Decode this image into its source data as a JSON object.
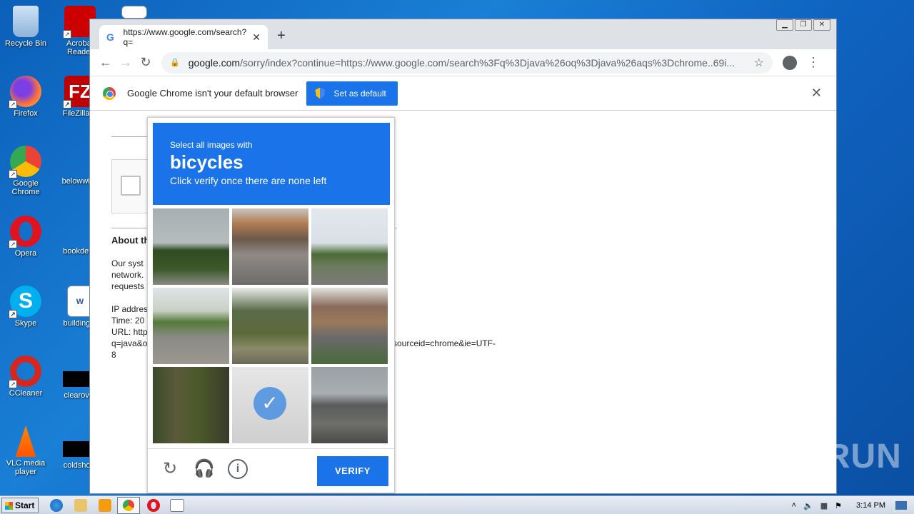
{
  "desktop": {
    "icons": [
      {
        "label": "Recycle Bin"
      },
      {
        "label": "Acrobat Reader"
      },
      {
        "label": "Firefox"
      },
      {
        "label": "FileZilla C"
      },
      {
        "label": "Google Chrome"
      },
      {
        "label": "belowwish"
      },
      {
        "label": "Opera"
      },
      {
        "label": "bookdetai"
      },
      {
        "label": "Skype"
      },
      {
        "label": "buildingtir"
      },
      {
        "label": "CCleaner"
      },
      {
        "label": "clearover"
      },
      {
        "label": "VLC media player"
      },
      {
        "label": "coldshoul"
      }
    ]
  },
  "browser": {
    "tab_title": "https://www.google.com/search?q=",
    "url_host": "google.com",
    "url_rest": "/sorry/index?continue=https://www.google.com/search%3Fq%3Djava%26oq%3Djava%26aqs%3Dchrome..69i...",
    "infobar_text": "Google Chrome isn't your default browser",
    "set_default_label": "Set as default"
  },
  "page": {
    "about_heading": "About th",
    "para_lines": [
      "Our syst",
      "network.",
      "requests"
    ],
    "ip_line": "IP addres",
    "time_line": "Time: 20",
    "url_line": "URL: http",
    "q_line": "q=java&o",
    "tail_line": "sourceid=chrome&ie=UTF-",
    "tail_line2": "8"
  },
  "captcha": {
    "line1": "Select all images with",
    "target": "bicycles",
    "line3": "Click verify once there are none left",
    "verify_label": "VERIFY",
    "selected_tile": 7
  },
  "watermark": "ANY RUN",
  "taskbar": {
    "start_label": "Start",
    "clock": "3:14 PM"
  },
  "colors": {
    "accent": "#1a73e8",
    "desktop": "#0b5fb8"
  }
}
